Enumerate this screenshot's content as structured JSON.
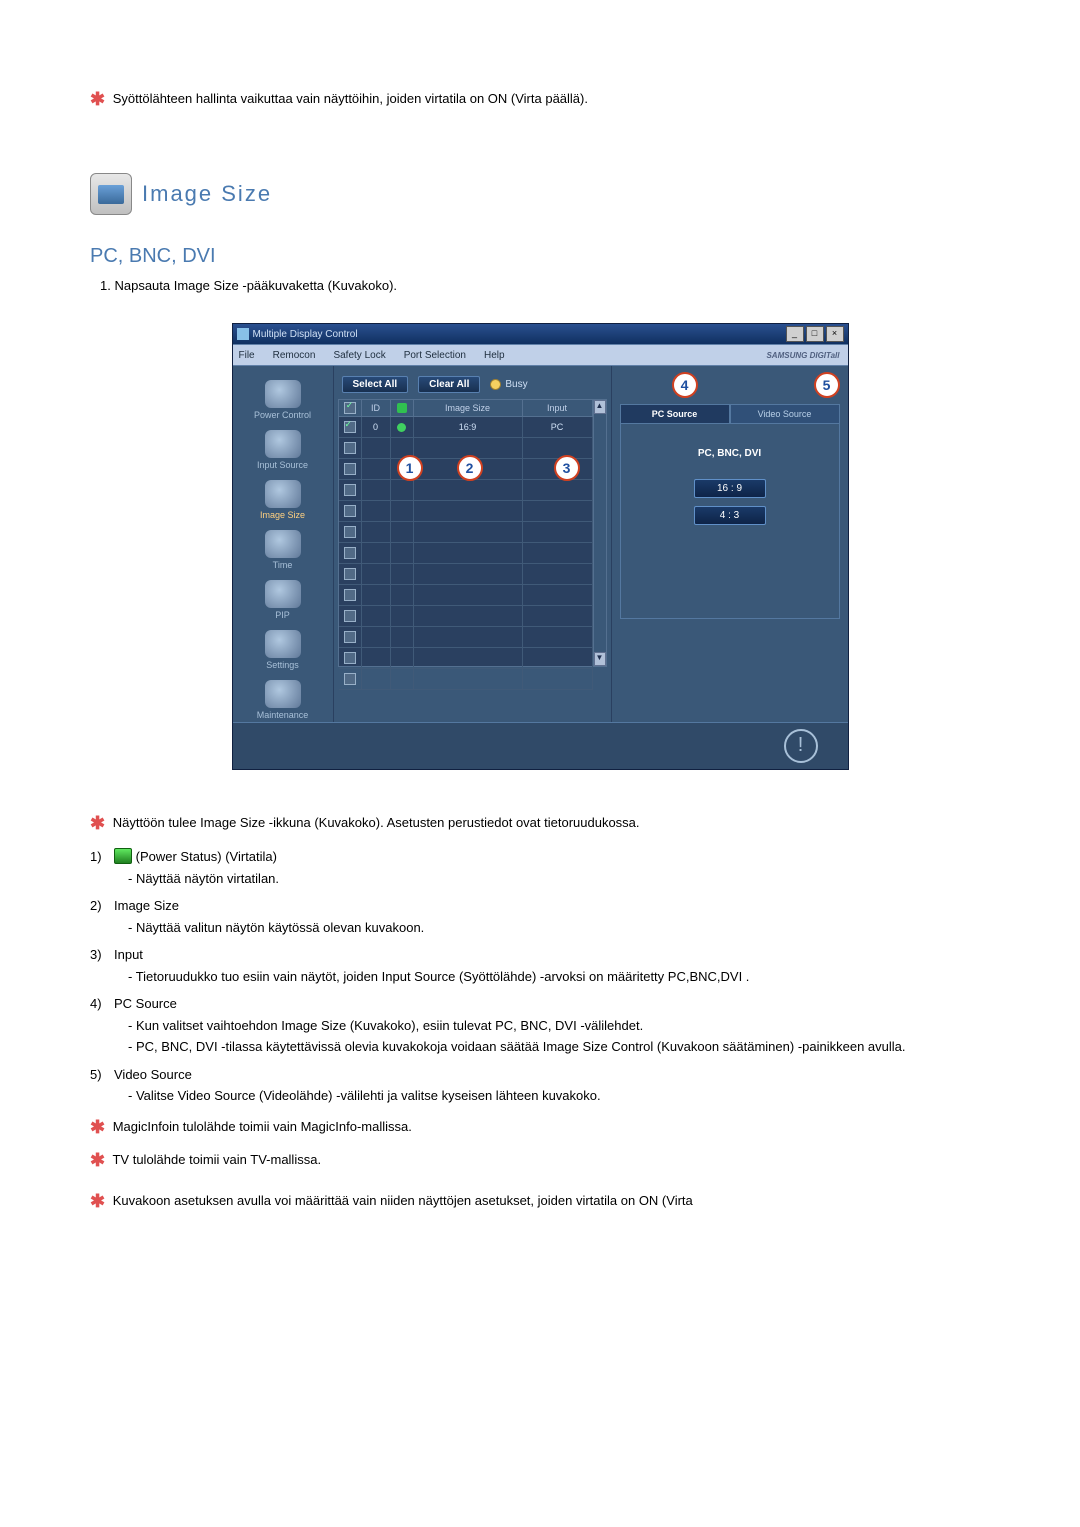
{
  "top_note": "Syöttölähteen hallinta vaikuttaa vain näyttöihin, joiden virtatila on ON (Virta päällä).",
  "section_title": "Image Size",
  "subheading": "PC, BNC, DVI",
  "step1": "Napsauta Image Size -pääkuvaketta (Kuvakoko).",
  "app": {
    "title": "Multiple Display Control",
    "menus": [
      "File",
      "Remocon",
      "Safety Lock",
      "Port Selection",
      "Help"
    ],
    "brand": "SAMSUNG DIGITall",
    "sidebar": [
      {
        "label": "Power Control"
      },
      {
        "label": "Input Source"
      },
      {
        "label": "Image Size"
      },
      {
        "label": "Time"
      },
      {
        "label": "PIP"
      },
      {
        "label": "Settings"
      },
      {
        "label": "Maintenance"
      }
    ],
    "select_all": "Select All",
    "clear_all": "Clear All",
    "busy": "Busy",
    "columns": {
      "id": "ID",
      "image_size": "Image Size",
      "input": "Input"
    },
    "row0": {
      "id": "0",
      "image_size": "16:9",
      "input": "PC"
    },
    "tabs": {
      "pc": "PC Source",
      "video": "Video Source"
    },
    "panel_label": "PC, BNC, DVI",
    "ratio1": "16 : 9",
    "ratio2": "4 : 3"
  },
  "desc_note": "Näyttöön tulee Image Size -ikkuna (Kuvakoko). Asetusten perustiedot ovat tietoruudukossa.",
  "legend": {
    "n1_title": "(Power Status) (Virtatila)",
    "n1_sub": "- Näyttää näytön virtatilan.",
    "n2_title": "Image Size",
    "n2_sub": "- Näyttää valitun näytön käytössä olevan kuvakoon.",
    "n3_title": "Input",
    "n3_sub": "- Tietoruudukko tuo esiin vain näytöt, joiden Input Source (Syöttölähde) -arvoksi on määritetty PC,BNC,DVI .",
    "n4_title": "PC Source",
    "n4_sub1": "- Kun valitset vaihtoehdon Image Size (Kuvakoko), esiin tulevat PC, BNC, DVI -välilehdet.",
    "n4_sub2": "- PC, BNC, DVI -tilassa käytettävissä olevia kuvakokoja voidaan säätää Image Size Control (Kuvakoon säätäminen) -painikkeen avulla.",
    "n5_title": "Video Source",
    "n5_sub": "- Valitse Video Source (Videolähde) -välilehti ja valitse kyseisen lähteen kuvakoko."
  },
  "note_magic": "MagicInfoin tulolähde toimii vain MagicInfo-mallissa.",
  "note_tv": "TV tulolähde toimii vain TV-mallissa.",
  "note_bottom": "Kuvakoon asetuksen avulla voi määrittää vain niiden näyttöjen asetukset, joiden virtatila on ON (Virta"
}
